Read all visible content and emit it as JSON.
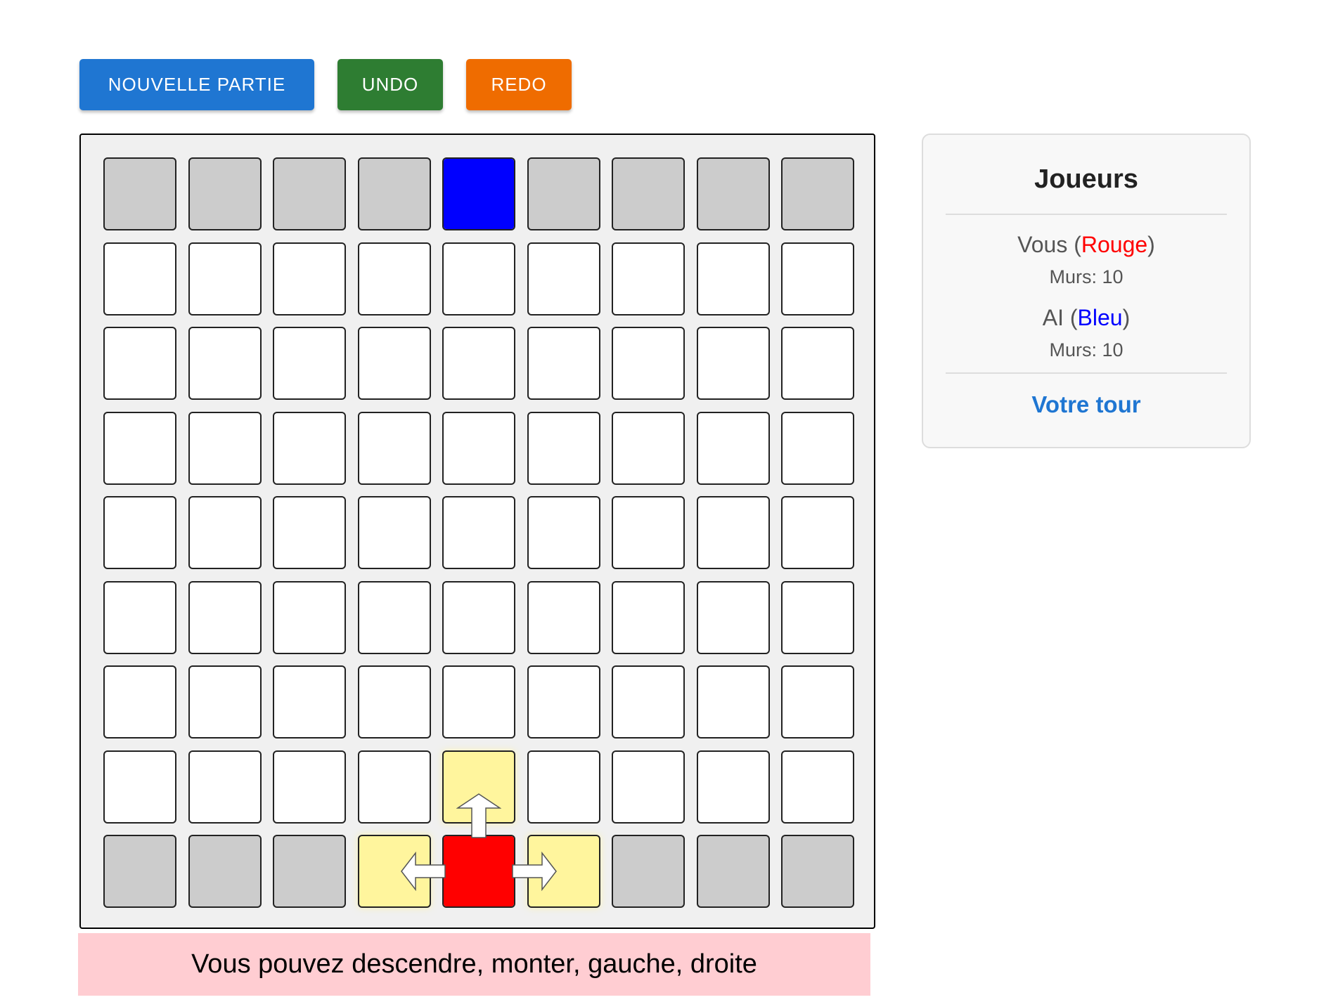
{
  "toolbar": {
    "new_game_label": "NOUVELLE PARTIE",
    "undo_label": "UNDO",
    "redo_label": "REDO"
  },
  "board": {
    "size": 9,
    "ai_pawn": {
      "row": 0,
      "col": 4,
      "color": "#0000ff"
    },
    "player_pawn": {
      "row": 8,
      "col": 4,
      "color": "#ff0000"
    },
    "valid_moves": [
      {
        "row": 7,
        "col": 4,
        "direction": "up"
      },
      {
        "row": 8,
        "col": 3,
        "direction": "left"
      },
      {
        "row": 8,
        "col": 5,
        "direction": "right"
      }
    ],
    "goal_rows": [
      0,
      8
    ],
    "colors": {
      "goal": "#cccccc",
      "cell": "#ffffff",
      "highlight": "#fff59d"
    }
  },
  "status": {
    "message": "Vous pouvez descendre, monter, gauche, droite"
  },
  "panel": {
    "title": "Joueurs",
    "player": {
      "name": "Vous",
      "color_name": "Rouge",
      "walls_label": "Murs: 10"
    },
    "ai": {
      "name": "AI",
      "color_name": "Bleu",
      "walls_label": "Murs: 10"
    },
    "turn_label": "Votre tour"
  }
}
